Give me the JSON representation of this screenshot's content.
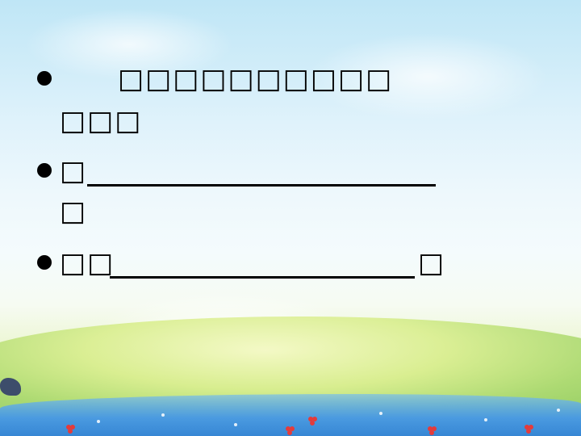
{
  "items": [
    {
      "line1": "　　□□□□□□□□□□",
      "line2": "□□□"
    },
    {
      "before_blank": "□",
      "after_blank": "□"
    },
    {
      "before_blank": "□□",
      "after_blank": "□"
    }
  ]
}
